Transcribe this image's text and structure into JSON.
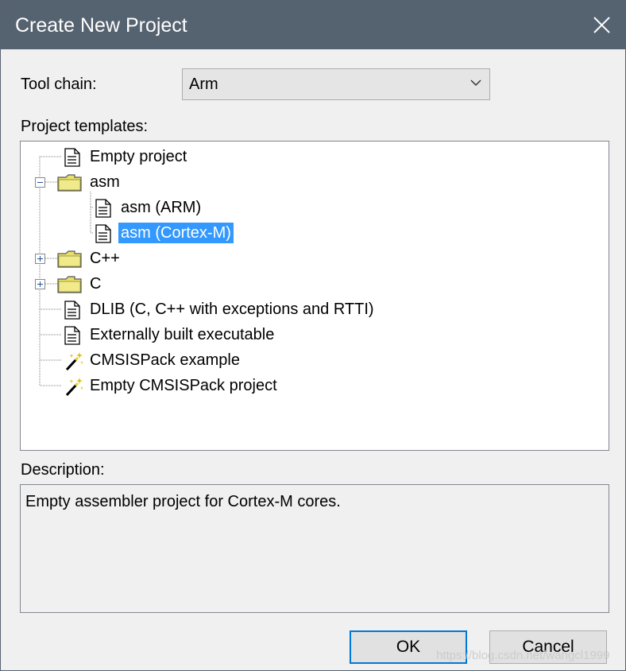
{
  "window": {
    "title": "Create New Project",
    "close_icon": "close-icon"
  },
  "toolchain": {
    "label": "Tool chain:",
    "value": "Arm"
  },
  "templates": {
    "label": "Project templates:",
    "items": [
      {
        "label": "Empty project",
        "icon": "document-icon",
        "level": 0
      },
      {
        "label": "asm",
        "icon": "folder-icon",
        "level": 0,
        "expander": "collapse"
      },
      {
        "label": "asm (ARM)",
        "icon": "document-icon",
        "level": 1
      },
      {
        "label": "asm (Cortex-M)",
        "icon": "document-icon",
        "level": 1,
        "selected": true
      },
      {
        "label": "C++",
        "icon": "folder-icon",
        "level": 0,
        "expander": "expand"
      },
      {
        "label": "C",
        "icon": "folder-icon",
        "level": 0,
        "expander": "expand"
      },
      {
        "label": "DLIB (C, C++ with exceptions and RTTI)",
        "icon": "document-icon",
        "level": 0
      },
      {
        "label": "Externally built executable",
        "icon": "document-icon",
        "level": 0
      },
      {
        "label": "CMSISPack example",
        "icon": "magic-wand-icon",
        "level": 0
      },
      {
        "label": "Empty CMSISPack project",
        "icon": "magic-wand-icon",
        "level": 0
      }
    ]
  },
  "description": {
    "label": "Description:",
    "text": "Empty assembler project for Cortex-M cores."
  },
  "buttons": {
    "ok": "OK",
    "cancel": "Cancel"
  },
  "watermark": "https://blog.csdn.net/wangcl1999",
  "colors": {
    "titlebar": "#556270",
    "selection": "#3399ff",
    "default_button_border": "#0078d7"
  }
}
